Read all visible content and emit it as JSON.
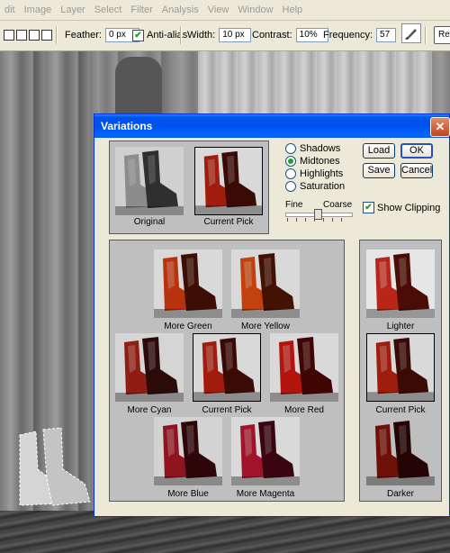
{
  "menu": [
    "dit",
    "Image",
    "Layer",
    "Select",
    "Filter",
    "Analysis",
    "View",
    "Window",
    "Help"
  ],
  "options": {
    "feather_label": "Feather:",
    "feather_value": "0 px",
    "antialias_label": "Anti-alias",
    "width_label": "Width:",
    "width_value": "10 px",
    "contrast_label": "Contrast:",
    "contrast_value": "10%",
    "frequency_label": "Frequency:",
    "frequency_value": "57",
    "refine_label": "Ref"
  },
  "dialog": {
    "title": "Variations",
    "close_glyph": "✕",
    "original_label": "Original",
    "current_pick_label": "Current Pick",
    "tone_options": [
      "Shadows",
      "Midtones",
      "Highlights",
      "Saturation"
    ],
    "selected_tone": "Midtones",
    "fine_label": "Fine",
    "coarse_label": "Coarse",
    "buttons": {
      "ok": "OK",
      "cancel": "Cancel",
      "load": "Load",
      "save": "Save"
    },
    "show_clipping_label": "Show Clipping",
    "show_clipping_checked": true,
    "color_variations": [
      "More Green",
      "More Yellow",
      "More Cyan",
      "Current Pick",
      "More Red",
      "More Blue",
      "More Magenta"
    ],
    "brightness_variations": [
      "Lighter",
      "Current Pick",
      "Darker"
    ]
  },
  "colors": {
    "xp_blue": "#0054e3",
    "dialog_bg": "#ece9d8",
    "boot_red": "#a01c0c"
  }
}
